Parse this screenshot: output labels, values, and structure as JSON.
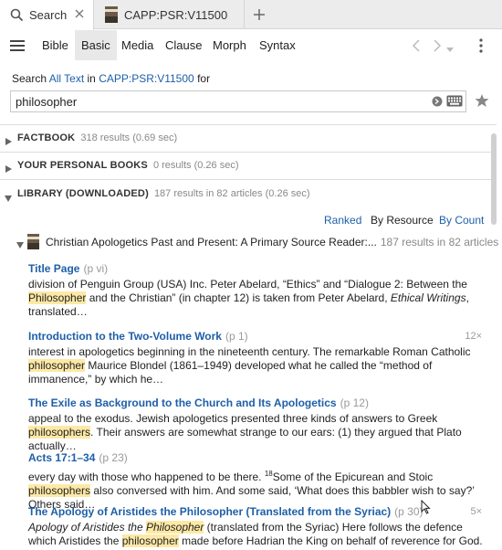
{
  "tabs": [
    {
      "label": "Search",
      "icon": "search-icon"
    },
    {
      "label": "CAPP:PSR:V11500",
      "icon": "book-cover-icon"
    }
  ],
  "toolbar": {
    "items": [
      "Bible",
      "Basic",
      "Media",
      "Clause",
      "Morph",
      "Syntax"
    ],
    "active": "Basic"
  },
  "search": {
    "prefix": "Search",
    "scope": "All Text",
    "in": "in",
    "resource": "CAPP:PSR:V11500",
    "suffix": "for",
    "query": "philosopher"
  },
  "sections": {
    "factbook": {
      "title": "FACTBOOK",
      "meta": "318 results (0.69 sec)"
    },
    "personal": {
      "title": "YOUR PERSONAL BOOKS",
      "meta": "0 results (0.26 sec)"
    },
    "library": {
      "title": "LIBRARY (DOWNLOADED)",
      "meta": "187 results in 82 articles (0.26 sec)"
    }
  },
  "sort": {
    "ranked": "Ranked",
    "by_resource": "By Resource",
    "by_count": "By Count"
  },
  "book": {
    "title": "Christian Apologetics Past and Present: A Primary Source Reader:...",
    "meta": "187 results in 82 articles"
  },
  "results": [
    {
      "title": "Title Page",
      "page": "(p vi)",
      "count": "",
      "snippet": [
        {
          "t": "division of Penguin Group (USA) Inc. Peter Abelard, “Ethics” and “Dialogue 2: Between the "
        },
        {
          "t": "Philosopher",
          "hl": true
        },
        {
          "t": " and the Christian” (in chapter 12) is taken from Peter Abelard, "
        },
        {
          "t": "Ethical Writings",
          "em": true
        },
        {
          "t": ", translated…"
        }
      ]
    },
    {
      "title": "Introduction to the Two-Volume Work",
      "page": "(p 1)",
      "count": "12×",
      "snippet": [
        {
          "t": "interest in apologetics beginning in the nineteenth century. The remarkable Roman Catholic "
        },
        {
          "t": "philosopher",
          "hl": true
        },
        {
          "t": " Maurice Blondel (1861–1949) developed what he called the “method of immanence,” by which he…"
        }
      ]
    },
    {
      "title": "The Exile as Background to the Church and Its Apologetics",
      "page": "(p 12)",
      "count": "",
      "snippet": [
        {
          "t": "appeal to the exodus. Jewish apologetics presented three kinds of answers to Greek "
        },
        {
          "t": "philosophers",
          "hl": true
        },
        {
          "t": ". Their answers are somewhat strange to our ears: (1) they argued that Plato actually…"
        }
      ]
    },
    {
      "title": "Acts 17:1–34",
      "page": "(p 23)",
      "count": "",
      "snippet": [
        {
          "t": "every day with those who happened to be there. "
        },
        {
          "t": "18",
          "sup": true
        },
        {
          "t": "Some of the Epicurean and Stoic "
        },
        {
          "t": "philosophers",
          "hl": true
        },
        {
          "t": " also conversed with him. And some said, ‘What does this babbler wish to say?’ Others said…"
        }
      ]
    },
    {
      "title": "The Apology of Aristides the Philosopher (Translated from the Syriac)",
      "page": "(p 30)",
      "count": "5×",
      "snippet": [
        {
          "t": "Apology of Aristides the ",
          "em": true
        },
        {
          "t": "Philosopher",
          "hl": true,
          "em": true
        },
        {
          "t": " (translated from the Syriac) Here follows the defence which Aristides the "
        },
        {
          "t": "philosopher",
          "hl": true
        },
        {
          "t": " made before Hadrian the King on behalf of reverence for God. … All…"
        }
      ]
    }
  ]
}
